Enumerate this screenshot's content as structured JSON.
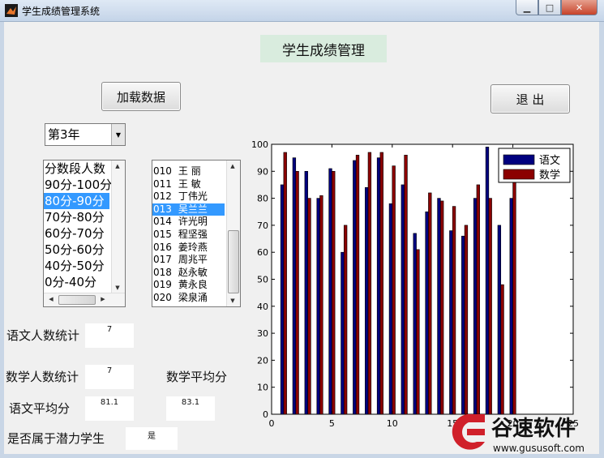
{
  "window": {
    "title": "学生成绩管理系统"
  },
  "header": {
    "title": "学生成绩管理"
  },
  "buttons": {
    "load": "加载数据",
    "exit": "退 出"
  },
  "year_select": {
    "value": "第3年"
  },
  "score_ranges": {
    "items": [
      "分数段人数",
      "90分-100分",
      "80分-90分",
      "70分-80分",
      "60分-70分",
      "50分-60分",
      "40分-50分",
      "0分-40分"
    ],
    "selected_index": 2
  },
  "students": {
    "items": [
      {
        "id": "010",
        "name": "王 丽"
      },
      {
        "id": "011",
        "name": "王 敏"
      },
      {
        "id": "012",
        "name": "丁伟光"
      },
      {
        "id": "013",
        "name": "吴兰兰"
      },
      {
        "id": "014",
        "name": "许光明"
      },
      {
        "id": "015",
        "name": "程坚强"
      },
      {
        "id": "016",
        "name": "姜玲燕"
      },
      {
        "id": "017",
        "name": "周兆平"
      },
      {
        "id": "018",
        "name": "赵永敏"
      },
      {
        "id": "019",
        "name": "黄永良"
      },
      {
        "id": "020",
        "name": "梁泉涌"
      }
    ],
    "selected_index": 3
  },
  "stats": {
    "chinese_count_label": "语文人数统计",
    "chinese_count": "7",
    "math_count_label": "数学人数统计",
    "math_count": "7",
    "math_avg_label": "数学平均分",
    "math_avg": "83.1",
    "chinese_avg_label": "语文平均分",
    "chinese_avg": "81.1",
    "potential_label": "是否属于潜力学生",
    "potential": "是"
  },
  "colors": {
    "chinese": "#00007f",
    "math": "#8b0000"
  },
  "chart_data": {
    "type": "bar",
    "x": [
      1,
      2,
      3,
      4,
      5,
      6,
      7,
      8,
      9,
      10,
      11,
      12,
      13,
      14,
      15,
      16,
      17,
      18,
      19,
      20,
      21
    ],
    "series": [
      {
        "name": "语文",
        "values": [
          85,
          95,
          90,
          80,
          91,
          60,
          94,
          84,
          95,
          78,
          85,
          67,
          75,
          80,
          68,
          66,
          80,
          99,
          70,
          80,
          0
        ]
      },
      {
        "name": "数学",
        "values": [
          97,
          90,
          80,
          81,
          90,
          70,
          96,
          97,
          97,
          92,
          96,
          61,
          82,
          79,
          77,
          70,
          85,
          80,
          48,
          88,
          0
        ]
      }
    ],
    "xlim": [
      0,
      25
    ],
    "ylim": [
      0,
      100
    ],
    "xticks": [
      "0",
      "5",
      "10",
      "15",
      "20",
      "25"
    ],
    "yticks": [
      "0",
      "10",
      "20",
      "30",
      "40",
      "50",
      "60",
      "70",
      "80",
      "90",
      "100"
    ],
    "legend": "top-right"
  },
  "watermark": {
    "text": "谷速软件",
    "url": "www.gususoft.com"
  }
}
